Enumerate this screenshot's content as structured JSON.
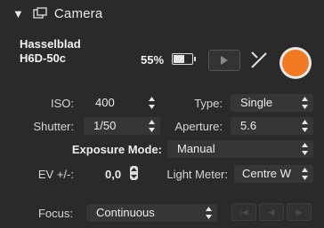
{
  "header": {
    "title": "Camera",
    "caret_icon": "disclosure-triangle-down",
    "section_icon": "camera-window-icon"
  },
  "camera": {
    "model_line1": "Hasselblad",
    "model_line2": "H6D-50c"
  },
  "battery": {
    "percent_label": "55%",
    "level": 0.55
  },
  "colors": {
    "accent": "#f27a22",
    "panel": "#2a2a2a",
    "field": "#363636"
  },
  "controls": {
    "iso": {
      "label": "ISO:",
      "value": "400"
    },
    "type": {
      "label": "Type:",
      "value": "Single"
    },
    "shutter": {
      "label": "Shutter:",
      "value": "1/50"
    },
    "aperture": {
      "label": "Aperture:",
      "value": "5.6"
    },
    "exposure_mode": {
      "label": "Exposure Mode:",
      "value": "Manual"
    },
    "ev": {
      "label": "EV +/-:",
      "value": "0,0"
    },
    "light_meter": {
      "label": "Light Meter:",
      "value": "Centre W"
    },
    "focus": {
      "label": "Focus:",
      "value": "Continuous"
    }
  },
  "focus_nav": {
    "buttons": [
      "|◀",
      "◀",
      "▶"
    ]
  }
}
